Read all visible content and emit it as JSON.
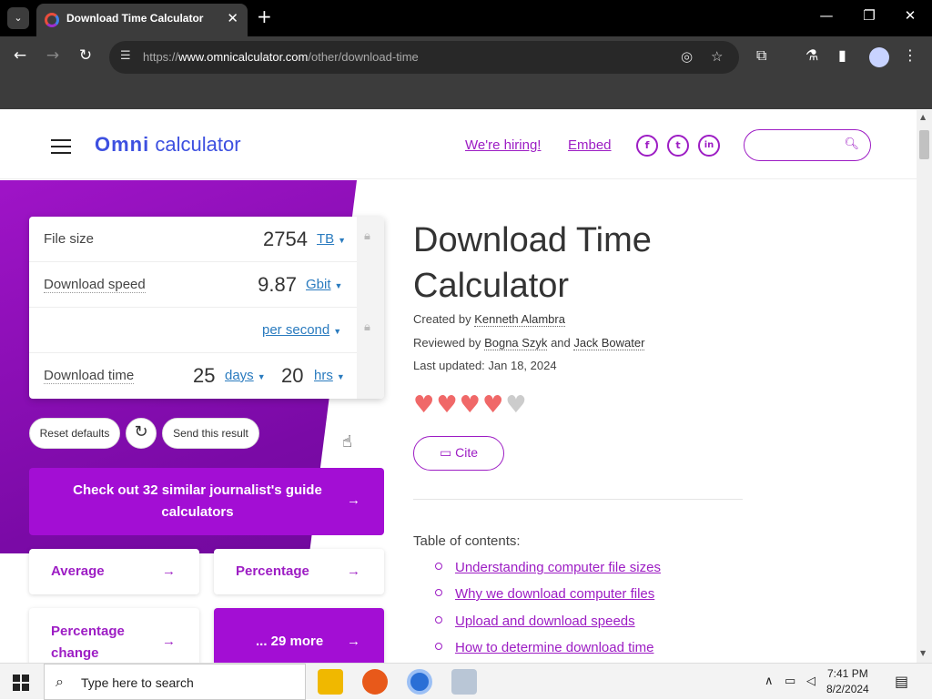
{
  "browser": {
    "tab_title": "Download Time Calculator",
    "url_prefix": "https://",
    "url_domain": "www.omnicalculator.com",
    "url_path": "/other/download-time"
  },
  "header": {
    "logo_omni": "Omni",
    "logo_calc": "calculator",
    "hiring": "We're hiring!",
    "embed": "Embed",
    "social": [
      "f",
      "t",
      "in"
    ]
  },
  "calculator": {
    "file_size_label": "File size",
    "file_size_value": "2754",
    "file_size_unit": "TB",
    "speed_label": "Download speed",
    "speed_value": "9.87",
    "speed_unit": "Gbit",
    "speed_per": "per second",
    "time_label": "Download time",
    "time_days_value": "25",
    "time_days_unit": "days",
    "time_hrs_value": "20",
    "time_hrs_unit": "hrs"
  },
  "actions": {
    "reset": "Reset defaults",
    "send": "Send this result"
  },
  "cta": {
    "text": "Check out 32 similar journalist's guide calculators"
  },
  "tiles": [
    "Average",
    "Percentage",
    "Percentage change",
    "... 29 more"
  ],
  "article": {
    "title_line1": "Download Time",
    "title_line2": "Calculator",
    "created_by_label": "Created by",
    "created_by": "Kenneth Alambra",
    "reviewed_by_label": "Reviewed by",
    "reviewer1": "Bogna Szyk",
    "and": "and",
    "reviewer2": "Jack Bowater",
    "updated": "Last updated: Jan 18, 2024",
    "rating": 4.5,
    "cite": "Cite",
    "toc_title": "Table of contents:",
    "toc": [
      "Understanding computer file sizes",
      "Why we download computer files",
      "Upload and download speeds",
      "How to determine download time"
    ]
  },
  "taskbar": {
    "search_placeholder": "Type here to search",
    "time": "7:41 PM",
    "date": "8/2/2024"
  }
}
